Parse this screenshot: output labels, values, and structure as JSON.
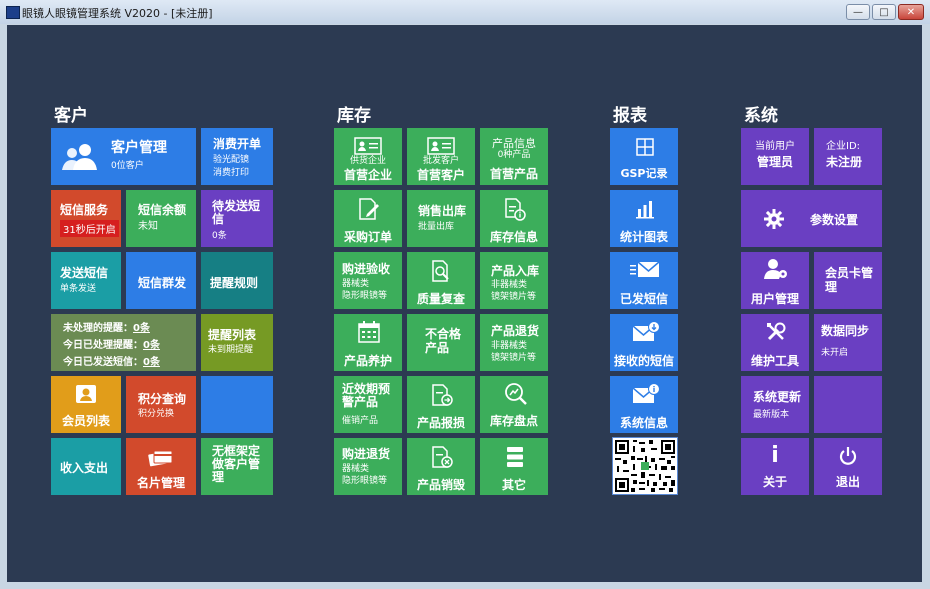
{
  "window": {
    "title": "眼镜人眼镜管理系统 V2020 - [未注册]",
    "minimize": "—",
    "maximize": "□",
    "close": "✕"
  },
  "sections": {
    "customer": "客户",
    "inventory": "库存",
    "reports": "报表",
    "system": "系统"
  },
  "customer": {
    "customer_mgmt": {
      "title": "客户管理",
      "sub": "0位客户"
    },
    "consume": {
      "title": "消费开单",
      "sub1": "验光配镜",
      "sub2": "消费打印"
    },
    "sms_service": {
      "title": "短信服务",
      "badge": "31秒后开启"
    },
    "sms_balance": {
      "title": "短信余额",
      "sub": "未知"
    },
    "to_send": {
      "title": "待发送短信",
      "sub": "0条"
    },
    "send_sms": {
      "title": "发送短信",
      "sub": "单条发送"
    },
    "sms_group": {
      "title": "短信群发"
    },
    "remind_rules": {
      "title": "提醒规则"
    },
    "reminders": {
      "row1_label": "未处理的提醒：",
      "row1_value": "0条",
      "row2_label": "今日已处理提醒：",
      "row2_value": "0条",
      "row3_label": "今日已发送短信：",
      "row3_value": "0条"
    },
    "remind_list": {
      "title": "提醒列表",
      "sub": "未到期提醒"
    },
    "member_list": {
      "title": "会员列表"
    },
    "points": {
      "title": "积分查询",
      "sub": "积分兑换"
    },
    "income": {
      "title": "收入支出"
    },
    "card_mgmt": {
      "title": "名片管理"
    },
    "frameless": {
      "title": "无框架定做客户管理"
    }
  },
  "inventory": {
    "supplier": {
      "label": "供货企业",
      "title": "首营企业"
    },
    "wholesale": {
      "label": "批发客户",
      "title": "首营客户"
    },
    "product_info": {
      "title": "产品信息",
      "sub": "0种产品",
      "title2": "首营产品"
    },
    "purchase_order": {
      "title": "采购订单"
    },
    "sales_out": {
      "title": "销售出库",
      "sub": "批量出库"
    },
    "stock_info": {
      "title": "库存信息"
    },
    "receive": {
      "title": "购进验收",
      "sub1": "器械类",
      "sub2": "隐形眼镜等"
    },
    "quality": {
      "title": "质量复查"
    },
    "product_in": {
      "title": "产品入库",
      "sub1": "非器械类",
      "sub2": "镜架镜片等"
    },
    "maintain": {
      "title": "产品养护"
    },
    "unqualified": {
      "title": "不合格产品"
    },
    "product_return": {
      "title": "产品退货",
      "sub1": "非器械类",
      "sub2": "镜架镜片等"
    },
    "near_expiry": {
      "title": "近效期预警产品",
      "sub": "催销产品"
    },
    "report_loss": {
      "title": "产品报损"
    },
    "stocktake": {
      "title": "库存盘点"
    },
    "purchase_return": {
      "title": "购进退货",
      "sub1": "器械类",
      "sub2": "隐形眼镜等"
    },
    "destroy": {
      "title": "产品销毁"
    },
    "other": {
      "title": "其它"
    }
  },
  "reports": {
    "gsp": {
      "title": "GSP记录"
    },
    "stats": {
      "title": "统计图表"
    },
    "sent_sms": {
      "title": "已发短信"
    },
    "received_sms": {
      "title": "接收的短信"
    },
    "sys_msg": {
      "title": "系统信息"
    }
  },
  "system": {
    "current_user": {
      "label": "当前用户",
      "value": "管理员"
    },
    "company_id": {
      "label": "企业ID:",
      "value": "未注册"
    },
    "settings": {
      "title": "参数设置"
    },
    "user_mgmt": {
      "title": "用户管理"
    },
    "member_card": {
      "title": "会员卡管理"
    },
    "maint_tool": {
      "title": "维护工具"
    },
    "data_sync": {
      "title": "数据同步",
      "sub": "未开启"
    },
    "update": {
      "title": "系统更新",
      "sub": "最新版本"
    },
    "about": {
      "title": "关于",
      "icon_char": "i"
    },
    "exit": {
      "title": "退出",
      "icon_char": "⏻"
    }
  },
  "icons": {
    "customer": "users-icon",
    "supplier": "id-card-icon",
    "purchase": "edit-document-icon",
    "stock": "document-info-icon",
    "quality": "document-search-icon",
    "maintain": "calendar-icon",
    "loss": "document-export-icon",
    "stocktake": "search-chart-icon",
    "destroy": "document-remove-icon",
    "other": "database-icon",
    "gsp": "grid-icon",
    "stats": "bar-chart-icon",
    "sent": "mail-send-icon",
    "received": "mail-download-icon",
    "info": "mail-info-icon",
    "settings": "gear-icon",
    "user": "user-gear-icon",
    "tools": "wrench-icon",
    "member": "id-card-icon",
    "qr": "qr-code-icon"
  },
  "colors": {
    "background": "#2c3a52",
    "blue": "#2d7de6",
    "green": "#3cae5b",
    "purple": "#6a3fc2",
    "red": "#d24a2c",
    "teal": "#1b9ea5",
    "orange": "#e19d1a"
  }
}
